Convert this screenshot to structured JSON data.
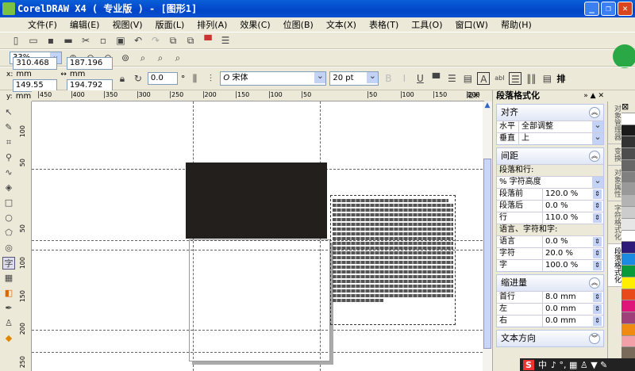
{
  "window": {
    "title": "CorelDRAW X4 ( 专业版 ) - [图形1]",
    "min": "_",
    "max": "❐",
    "close": "✕"
  },
  "menu": [
    "文件(F)",
    "编辑(E)",
    "视图(V)",
    "版面(L)",
    "排列(A)",
    "效果(C)",
    "位图(B)",
    "文本(X)",
    "表格(T)",
    "工具(O)",
    "窗口(W)",
    "帮助(H)"
  ],
  "zoom": {
    "value": "33%"
  },
  "properties": {
    "x_label": "x:",
    "x": "310.468 mm",
    "y_label": "y:",
    "y": "149.55 mm",
    "width": "187.196 mm",
    "height": "194.792 mm",
    "rotation": "0.0",
    "degree": "°",
    "font": "宋体",
    "font_prefix": "O",
    "size": "20 pt",
    "arrange_label": "排"
  },
  "ruler": {
    "h_ticks": [
      "450",
      "400",
      "350",
      "300",
      "250",
      "200",
      "150",
      "100",
      "50",
      "",
      "50",
      "100",
      "150",
      "200"
    ],
    "unit": "毫米",
    "v_ticks": [
      "100",
      "50",
      "",
      "50",
      "100",
      "150",
      "200",
      "250"
    ]
  },
  "docker": {
    "title": "段落格式化",
    "align": {
      "header": "对齐",
      "rows": [
        {
          "label": "水平",
          "value": "全部调整"
        },
        {
          "label": "垂直",
          "value": "上"
        }
      ]
    },
    "spacing": {
      "header": "间距",
      "sub1": "段落和行:",
      "unit": "% 字符高度",
      "rows": [
        {
          "label": "段落前",
          "value": "120.0 %"
        },
        {
          "label": "段落后",
          "value": "0.0 %"
        },
        {
          "label": "行",
          "value": "110.0 %"
        }
      ],
      "sub2": "语言、字符和字:",
      "rows2": [
        {
          "label": "语言",
          "value": "0.0 %"
        },
        {
          "label": "字符",
          "value": "20.0 %"
        },
        {
          "label": "字",
          "value": "100.0 %"
        }
      ]
    },
    "indent": {
      "header": "缩进量",
      "rows": [
        {
          "label": "首行",
          "value": "8.0 mm"
        },
        {
          "label": "左",
          "value": "0.0 mm"
        },
        {
          "label": "右",
          "value": "0.0 mm"
        }
      ]
    },
    "direction": {
      "header": "文本方向"
    }
  },
  "side_tabs": [
    "对象管理器",
    "变换",
    "对象属性",
    "字符格式化",
    "段落格式化"
  ],
  "palette": [
    "#ffffff",
    "#1a1a1a",
    "#333333",
    "#4d4d4d",
    "#666666",
    "#808080",
    "#999999",
    "#b3b3b3",
    "#cccccc",
    "#e6e6e6",
    "#ffffff",
    "#2e1a78",
    "#1a8be0",
    "#0a9a3a",
    "#ffee00",
    "#e84a1a",
    "#e0157a",
    "#a0407a",
    "#f08a10",
    "#f4a0a8",
    "#7a6a5a",
    "#c8b8e0"
  ],
  "canvas": {
    "fill_color": "#231f1c"
  },
  "ime": {
    "label": "中"
  }
}
